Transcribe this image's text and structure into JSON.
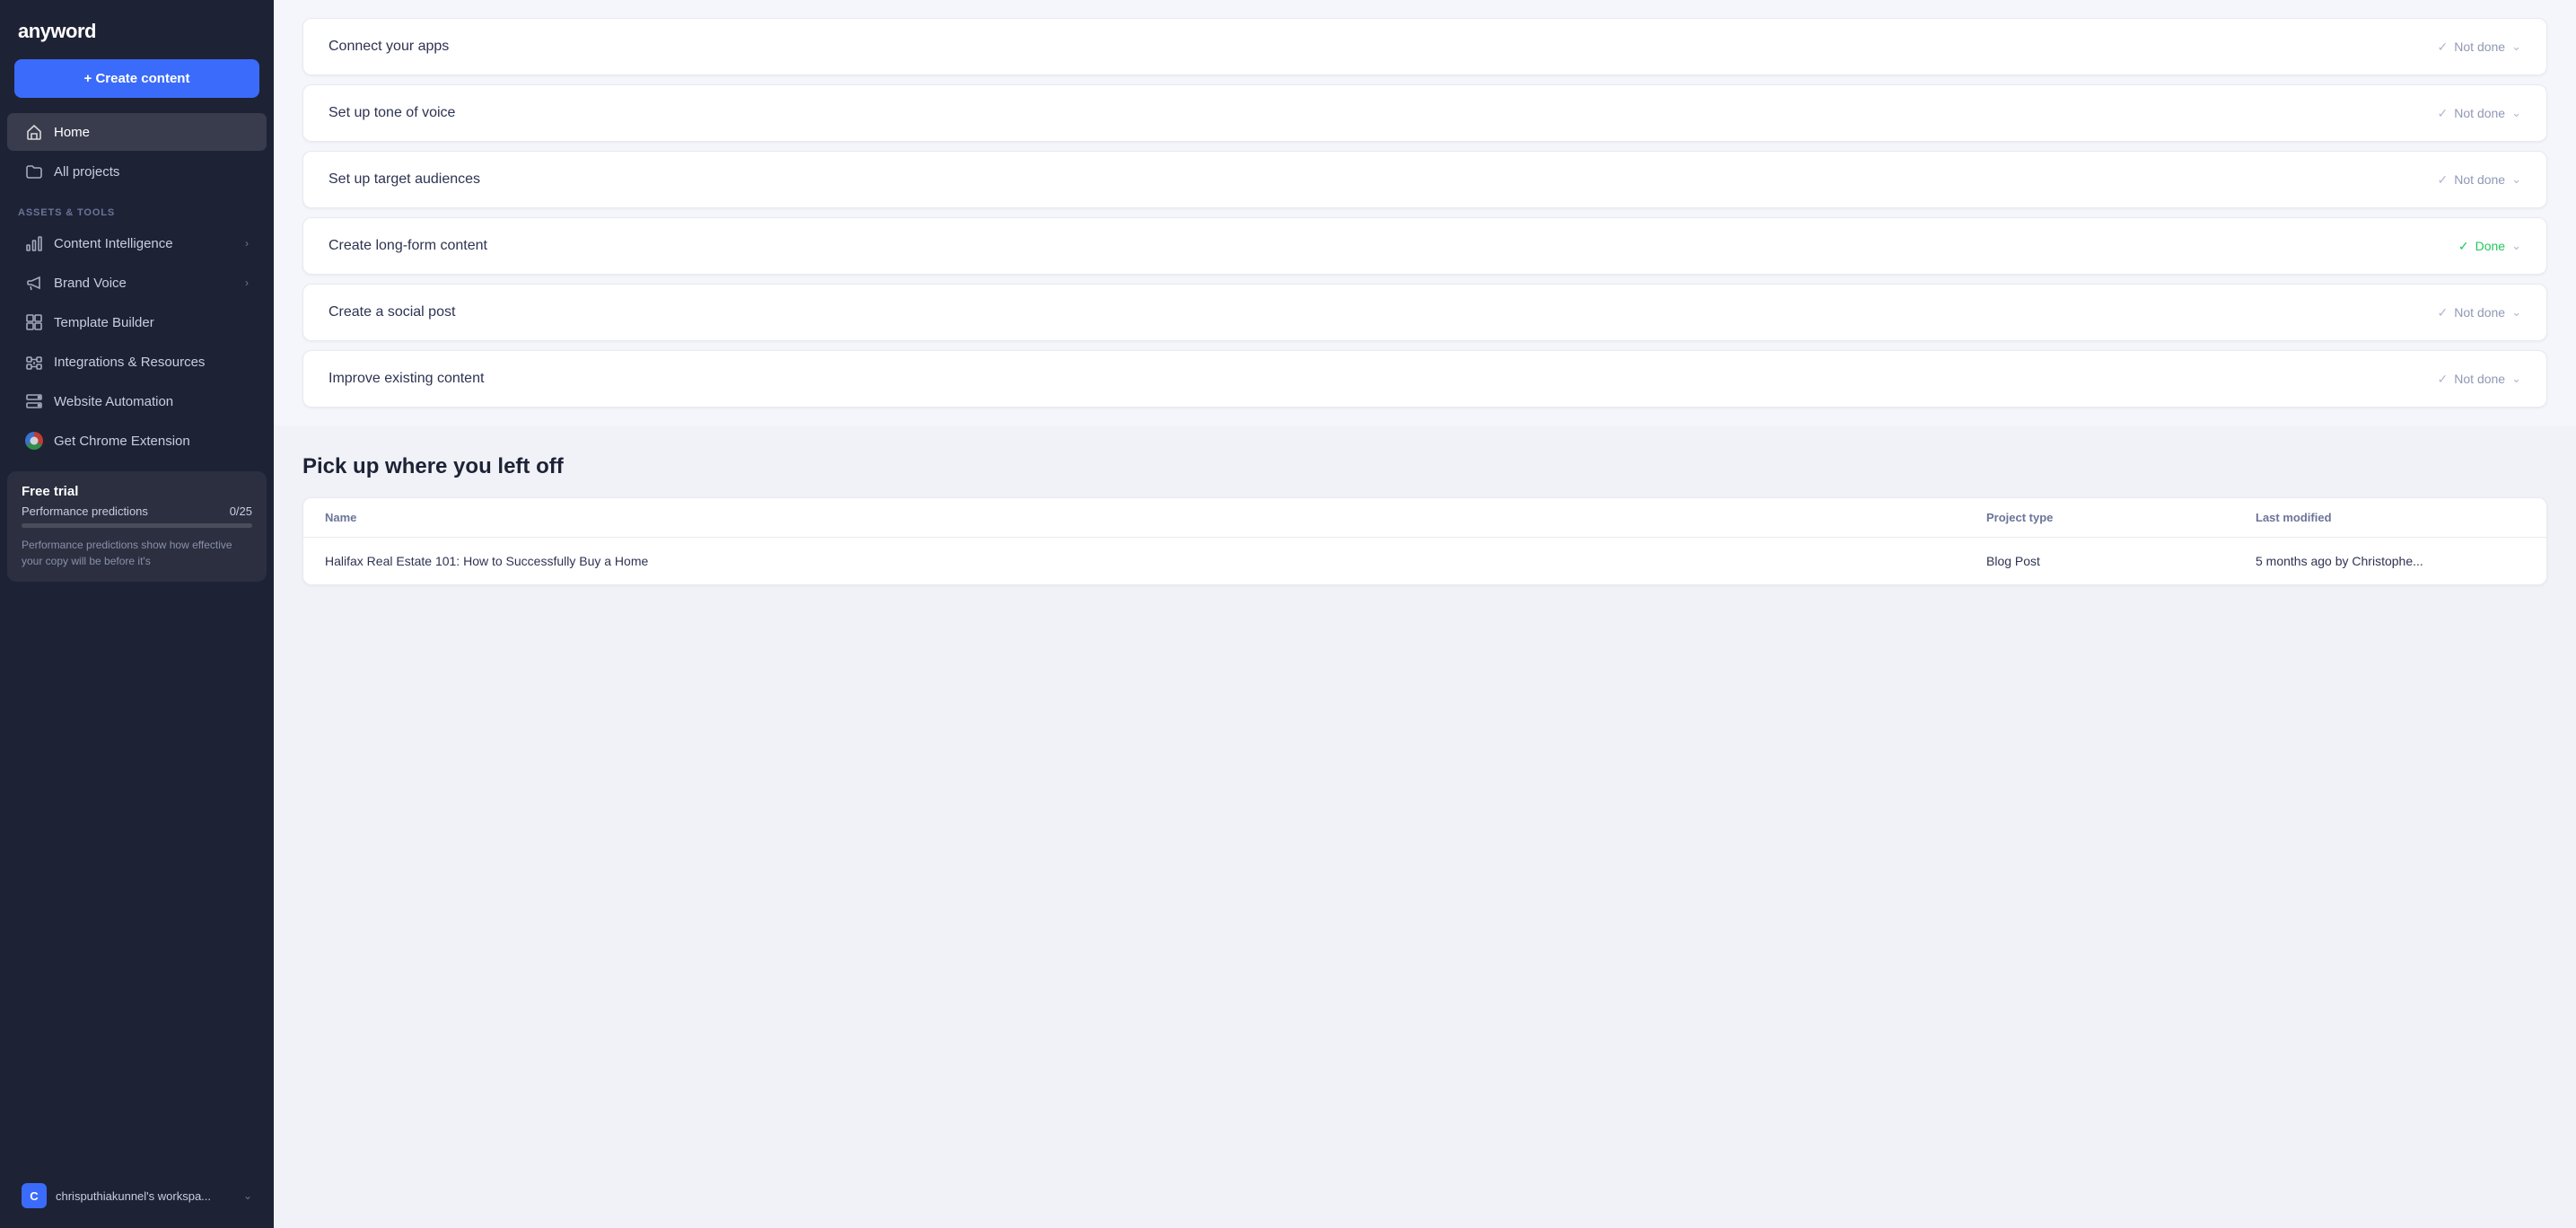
{
  "app": {
    "logo": "anyword"
  },
  "sidebar": {
    "create_button_label": "+ Create content",
    "nav_items": [
      {
        "id": "home",
        "label": "Home",
        "active": true
      },
      {
        "id": "all-projects",
        "label": "All projects",
        "active": false
      }
    ],
    "assets_section_label": "ASSETS & TOOLS",
    "tools": [
      {
        "id": "content-intelligence",
        "label": "Content Intelligence",
        "has_chevron": true
      },
      {
        "id": "brand-voice",
        "label": "Brand Voice",
        "has_chevron": true
      },
      {
        "id": "template-builder",
        "label": "Template Builder",
        "has_chevron": false
      },
      {
        "id": "integrations",
        "label": "Integrations & Resources",
        "has_chevron": false
      },
      {
        "id": "website-automation",
        "label": "Website Automation",
        "has_chevron": false
      },
      {
        "id": "chrome-extension",
        "label": "Get Chrome Extension",
        "has_chevron": false
      }
    ],
    "free_trial": {
      "title": "Free trial",
      "perf_label": "Performance predictions",
      "perf_value": "0/25",
      "perf_progress": 0,
      "description": "Performance predictions show how effective your copy will be before it's"
    },
    "workspace": {
      "avatar_letter": "C",
      "name": "chrisputhiakunnel's workspa..."
    }
  },
  "checklist": {
    "items": [
      {
        "id": "connect-apps",
        "title": "Connect your apps",
        "status": "Not done",
        "done": false
      },
      {
        "id": "set-up-tone",
        "title": "Set up tone of voice",
        "status": "Not done",
        "done": false
      },
      {
        "id": "set-up-audiences",
        "title": "Set up target audiences",
        "status": "Not done",
        "done": false
      },
      {
        "id": "create-longform",
        "title": "Create long-form content",
        "status": "Done",
        "done": true
      },
      {
        "id": "create-social",
        "title": "Create a social post",
        "status": "Not done",
        "done": false
      },
      {
        "id": "improve-existing",
        "title": "Improve existing content",
        "status": "Not done",
        "done": false
      }
    ]
  },
  "pickup": {
    "title": "Pick up where you left off",
    "table_headers": {
      "name": "Name",
      "project_type": "Project type",
      "last_modified": "Last modified"
    },
    "rows": [
      {
        "name": "Halifax Real Estate 101: How to Successfully Buy a Home",
        "project_type": "Blog Post",
        "last_modified": "5 months ago by Christophe..."
      }
    ]
  }
}
